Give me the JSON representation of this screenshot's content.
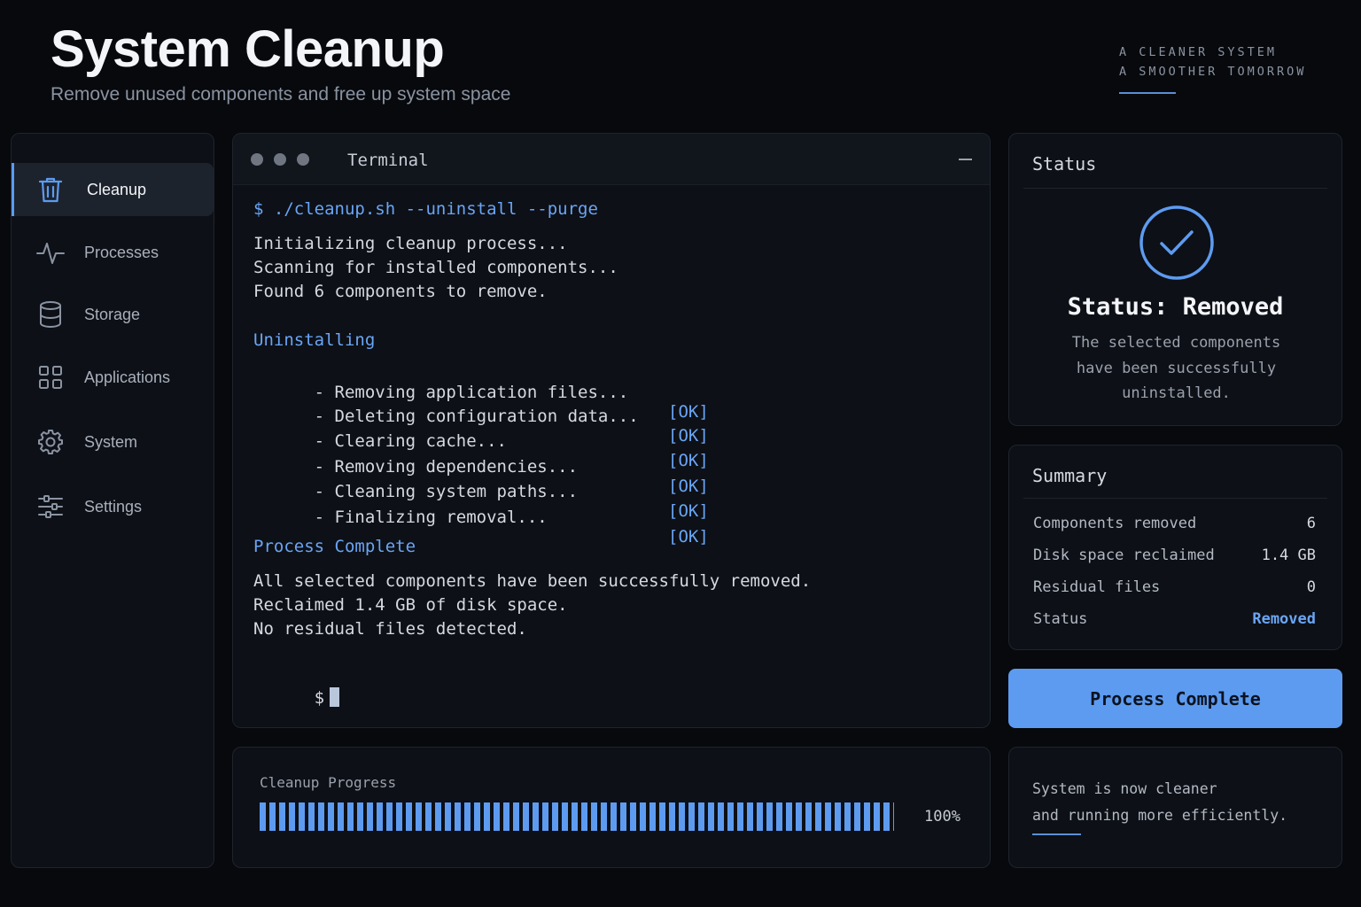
{
  "header": {
    "title": "System Cleanup",
    "subtitle": "Remove unused components and free up system space",
    "tagline_line1": "A CLEANER SYSTEM",
    "tagline_line2": "A SMOOTHER TOMORROW"
  },
  "sidebar": {
    "items": [
      {
        "label": "Cleanup",
        "icon": "trash-icon",
        "active": true
      },
      {
        "label": "Processes",
        "icon": "activity-icon",
        "active": false
      },
      {
        "label": "Storage",
        "icon": "database-icon",
        "active": false
      },
      {
        "label": "Applications",
        "icon": "grid-icon",
        "active": false
      },
      {
        "label": "System",
        "icon": "gear-icon",
        "active": false
      },
      {
        "label": "Settings",
        "icon": "sliders-icon",
        "active": false
      }
    ]
  },
  "terminal": {
    "title": "Terminal",
    "command": "$ ./cleanup.sh --uninstall --purge",
    "init_lines": [
      "Initializing cleanup process...",
      "Scanning for installed components...",
      "Found 6 components to remove."
    ],
    "section_uninstalling": "Uninstalling",
    "steps": [
      {
        "text": "- Removing application files...",
        "result": "[OK]"
      },
      {
        "text": "- Deleting configuration data...",
        "result": "[OK]"
      },
      {
        "text": "- Clearing cache...",
        "result": "[OK]"
      },
      {
        "text": "- Removing dependencies...",
        "result": "[OK]"
      },
      {
        "text": "- Cleaning system paths...",
        "result": "[OK]"
      },
      {
        "text": "- Finalizing removal...",
        "result": "[OK]"
      }
    ],
    "section_complete": "Process Complete",
    "result_lines": [
      "All selected components have been successfully removed.",
      "Reclaimed 1.4 GB of disk space.",
      "No residual files detected."
    ],
    "prompt": "$"
  },
  "progress": {
    "label": "Cleanup Progress",
    "percent_text": "100%",
    "fraction": 1.0
  },
  "status": {
    "title": "Status",
    "heading": "Status: Removed",
    "description": "The selected components have been successfully uninstalled."
  },
  "summary": {
    "title": "Summary",
    "rows": [
      {
        "label": "Components removed",
        "value": "6"
      },
      {
        "label": "Disk space reclaimed",
        "value": "1.4 GB"
      },
      {
        "label": "Residual files",
        "value": "0"
      },
      {
        "label": "Status",
        "value": "Removed"
      }
    ]
  },
  "button": {
    "label": "Process Complete"
  },
  "note": {
    "line1": "System is now cleaner",
    "line2": "and running more efficiently."
  },
  "colors": {
    "accent": "#5d9bf0",
    "background": "#07090d",
    "panel": "#0d1016"
  }
}
